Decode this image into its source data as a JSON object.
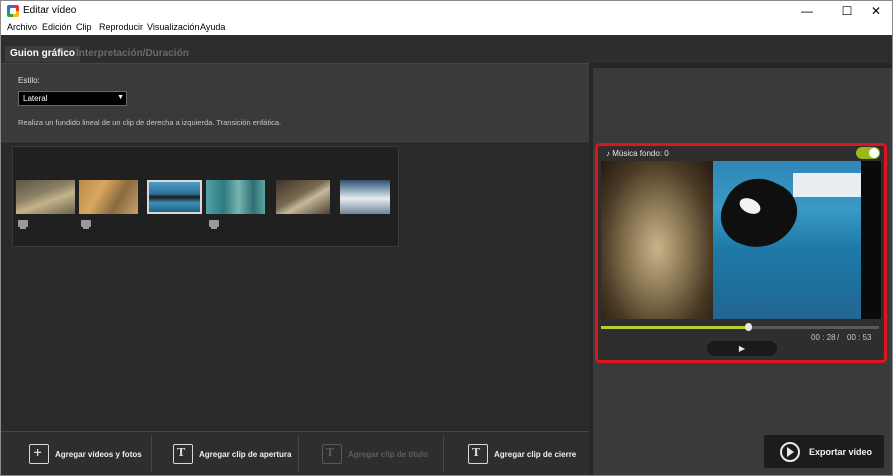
{
  "window": {
    "title": "Editar vídeo",
    "minimize": "—",
    "maximize": "☐",
    "close": "✕"
  },
  "menu": [
    "Archivo",
    "Edición",
    "Clip",
    "Reproducir",
    "Visualización",
    "Ayuda"
  ],
  "tabs": {
    "active": "Guion gráfico",
    "inactive": "Interpretación/Duración"
  },
  "style": {
    "label": "Estilo:",
    "selected": "Lateral",
    "description": "Realiza un fundido lineal de un clip de derecha a izquierda. Transición enfática."
  },
  "bottom_buttons": {
    "add_media": "Agregar vídeos y fotos",
    "add_opening": "Agregar clip de apertura",
    "add_title": "Agregar clip de título",
    "add_closing": "Agregar clip de cierre"
  },
  "preview": {
    "music_label": "Música fondo: 0",
    "time_current": "00 : 28",
    "time_separator": "/",
    "time_total": "00 : 53",
    "progress": 0.528
  },
  "export": {
    "label": "Exportar vídeo"
  },
  "colors": {
    "accent_green": "#b6d030",
    "highlight_red": "#e0141e"
  },
  "icons": [
    "app-icon",
    "video-camera-icon",
    "music-note-icon",
    "speaker-icon",
    "play-icon",
    "export-icon"
  ]
}
